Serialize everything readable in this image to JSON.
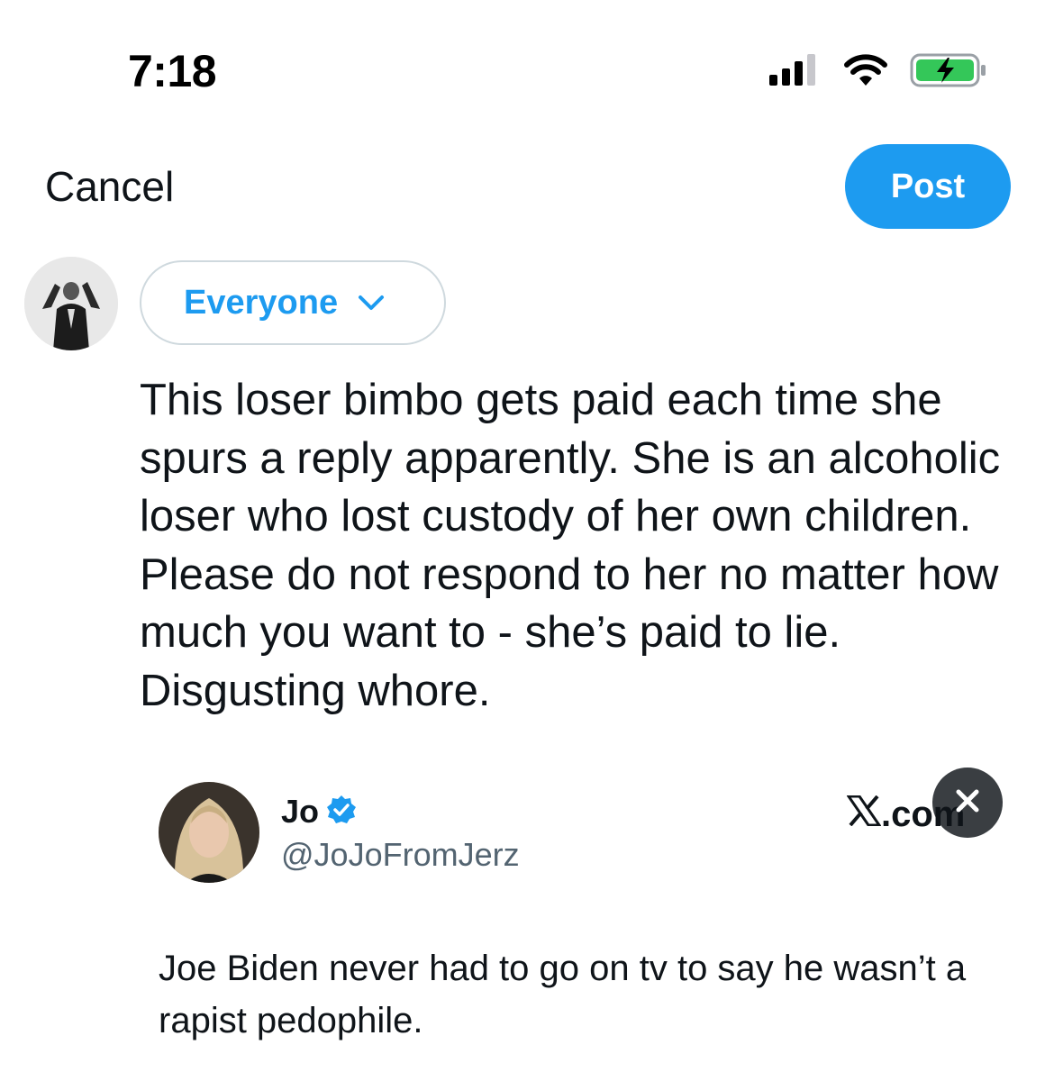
{
  "status_bar": {
    "time": "7:18",
    "icons": [
      "signal-icon",
      "wifi-icon",
      "battery-charging-icon"
    ],
    "battery_color": "#34c759"
  },
  "header": {
    "cancel_label": "Cancel",
    "post_label": "Post"
  },
  "composer": {
    "audience_label": "Everyone",
    "text": "This loser bimbo gets paid each time she spurs a reply apparently. She is an alcoholic loser who lost custody of her own children. Please do not respond to her no matter how much you want to - she’s paid to lie. Disgusting whore."
  },
  "quoted_post": {
    "author_name": "Jo",
    "verified": true,
    "handle": "@JoJoFromJerz",
    "source": ".com",
    "text": "Joe Biden never had to go on tv to say he wasn’t a rapist pedophile."
  },
  "colors": {
    "accent": "#1d9bf0",
    "text": "#0f1419",
    "secondary_text": "#536471",
    "border": "#cfd9de"
  }
}
